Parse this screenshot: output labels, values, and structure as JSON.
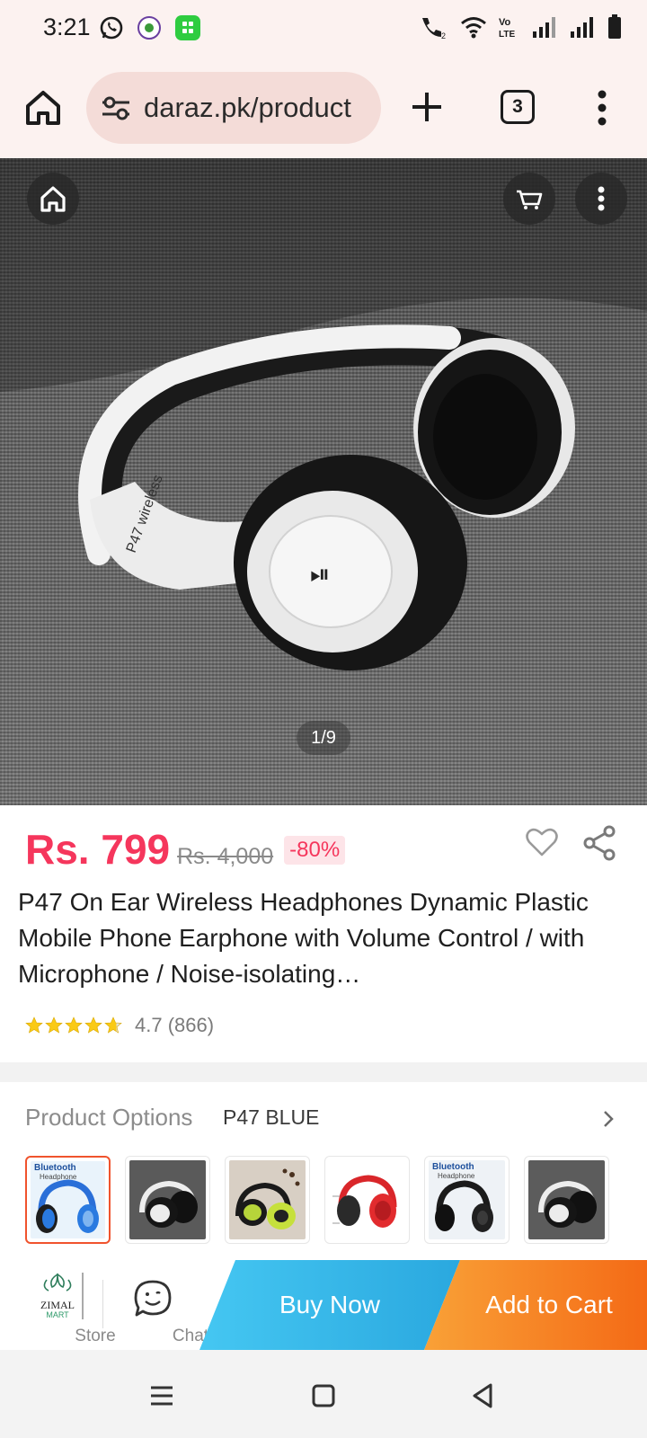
{
  "status_bar": {
    "time": "3:21",
    "left_icons": [
      "whatsapp-icon",
      "app-notification-icon",
      "app-store-icon"
    ],
    "right_icons": [
      "wifi-calling-icon",
      "wifi-icon",
      "volte-icon",
      "signal-1-icon",
      "signal-2-icon",
      "battery-icon"
    ],
    "volte_text": "Vo LTE",
    "wifi_call_sub": "2"
  },
  "browser": {
    "url": "daraz.pk/product",
    "tab_count": "3"
  },
  "gallery": {
    "counter": "1/9"
  },
  "product": {
    "price": "Rs. 799",
    "original_price": "Rs. 4,000",
    "discount": "-80%",
    "title": "P47 On Ear Wireless Headphones Dynamic Plastic Mobile Phone Earphone with Volume Control / with Microphone / Noise-isolating…",
    "rating": 4.7,
    "rating_text": "4.7 (866)"
  },
  "options": {
    "label": "Product Options",
    "selected_value": "P47 BLUE",
    "thumbnails": [
      {
        "name": "blue",
        "text": "Bluetooth",
        "subtext": "Headphone",
        "selected": true
      },
      {
        "name": "white-black",
        "selected": false
      },
      {
        "name": "green",
        "selected": false
      },
      {
        "name": "red",
        "selected": false
      },
      {
        "name": "black",
        "text": "Bluetooth",
        "subtext": "Headphone",
        "selected": false
      },
      {
        "name": "white",
        "selected": false
      }
    ]
  },
  "actions": {
    "store_label": "Store",
    "store_logo_text": "ZIMAL",
    "store_logo_subtext": "MART",
    "chat_label": "Chat",
    "buy_now": "Buy Now",
    "add_to_cart": "Add to Cart"
  },
  "colors": {
    "price": "#f5365c",
    "buy_now": "#2aa8df",
    "add_to_cart": "#f46a16",
    "browser_bar": "#fcf2f0"
  }
}
